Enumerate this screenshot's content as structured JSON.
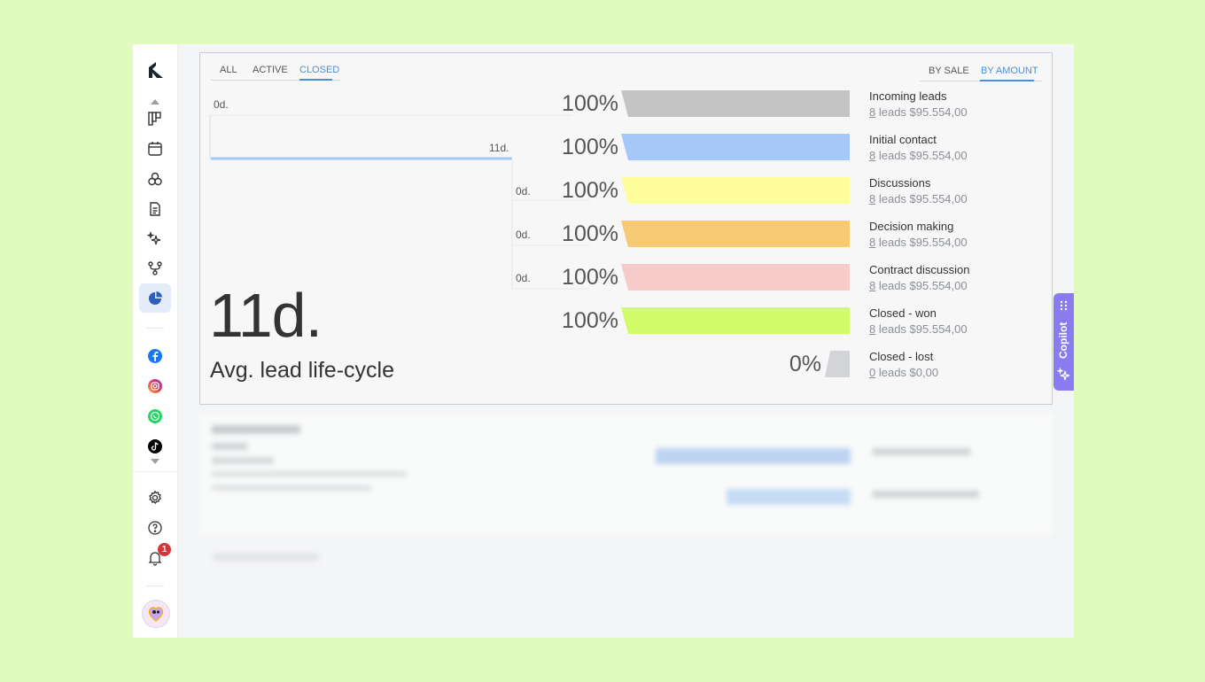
{
  "sidebar": {
    "logo": "K",
    "icons": [
      {
        "name": "pipeline-icon"
      },
      {
        "name": "calendar-icon"
      },
      {
        "name": "contacts-icon"
      },
      {
        "name": "document-icon"
      },
      {
        "name": "sparkles-icon"
      },
      {
        "name": "workflow-icon"
      },
      {
        "name": "pie-chart-icon"
      }
    ],
    "social": [
      "facebook-icon",
      "instagram-icon",
      "whatsapp-icon",
      "tiktok-icon"
    ],
    "notification_count": "1"
  },
  "tabs": {
    "left": [
      "ALL",
      "ACTIVE",
      "CLOSED"
    ],
    "left_active": "CLOSED",
    "right": [
      "BY SALE",
      "BY AMOUNT"
    ],
    "right_active": "BY AMOUNT"
  },
  "lifecycle": {
    "value": "11d.",
    "label": "Avg. lead life-cycle",
    "step_labels": [
      "0d.",
      "11d.",
      "0d.",
      "0d.",
      "0d."
    ]
  },
  "stages": [
    {
      "name": "Incoming leads",
      "count": "8",
      "rest": " leads $95.554,00",
      "pct": "100%",
      "color": "#c4c4c4",
      "fill": 1.0
    },
    {
      "name": "Initial contact",
      "count": "8",
      "rest": " leads $95.554,00",
      "pct": "100%",
      "color": "#a6c8f8",
      "fill": 1.0
    },
    {
      "name": "Discussions",
      "count": "8",
      "rest": " leads $95.554,00",
      "pct": "100%",
      "color": "#fdfd9c",
      "fill": 1.0
    },
    {
      "name": "Decision making",
      "count": "8",
      "rest": " leads $95.554,00",
      "pct": "100%",
      "color": "#f7ca74",
      "fill": 1.0
    },
    {
      "name": "Contract discussion",
      "count": "8",
      "rest": " leads $95.554,00",
      "pct": "100%",
      "color": "#f8cbcb",
      "fill": 1.0
    },
    {
      "name": "Closed - won",
      "count": "8",
      "rest": " leads $95.554,00",
      "pct": "100%",
      "color": "#d1fb69",
      "fill": 1.0
    },
    {
      "name": "Closed - lost",
      "count": "0",
      "rest": " leads $0,00",
      "pct": "0%",
      "color": "#d2d4d8",
      "fill": 0.0
    }
  ],
  "copilot": {
    "label": "Copilot"
  }
}
